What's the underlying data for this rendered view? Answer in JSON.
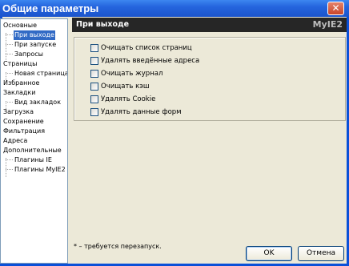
{
  "window": {
    "title": "Общие параметры",
    "close_glyph": "✕"
  },
  "tree": {
    "items": [
      {
        "label": "Основные"
      },
      {
        "label": "При выходе"
      },
      {
        "label": "При запуске"
      },
      {
        "label": "Запросы"
      },
      {
        "label": "Страницы"
      },
      {
        "label": "Новая страница"
      },
      {
        "label": "Избранное"
      },
      {
        "label": "Закладки"
      },
      {
        "label": "Вид закладок"
      },
      {
        "label": "Загрузка"
      },
      {
        "label": "Сохранение"
      },
      {
        "label": "Фильтрация"
      },
      {
        "label": "Адреса"
      },
      {
        "label": "Дополнительные"
      },
      {
        "label": "Плагины IE"
      },
      {
        "label": "Плагины MyIE2"
      }
    ],
    "selected": "При выходе"
  },
  "page": {
    "title": "При выходе",
    "brand": "MyIE2"
  },
  "options": [
    {
      "label": "Очищать список страниц",
      "checked": false
    },
    {
      "label": "Удалять введённые адреса",
      "checked": false
    },
    {
      "label": "Очищать журнал",
      "checked": false
    },
    {
      "label": "Очищать кэш",
      "checked": false
    },
    {
      "label": "Удалять Cookie",
      "checked": false
    },
    {
      "label": "Удалять данные форм",
      "checked": false
    }
  ],
  "note": "* – требуется перезапуск.",
  "buttons": {
    "ok": "OK",
    "cancel": "Отмена"
  }
}
